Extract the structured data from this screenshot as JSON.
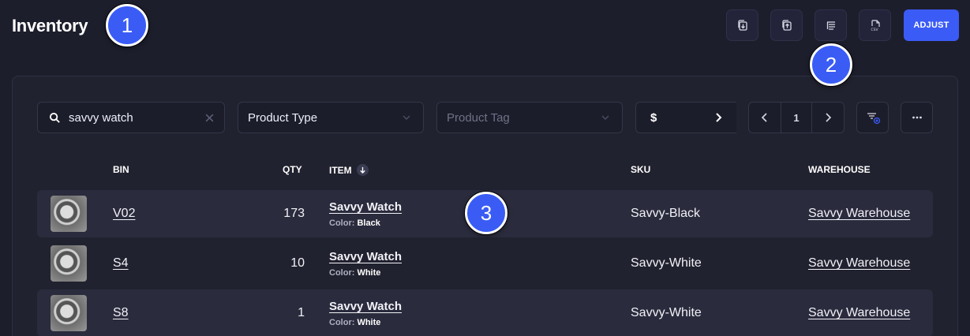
{
  "page": {
    "title": "Inventory"
  },
  "callouts": [
    "1",
    "2",
    "3"
  ],
  "toolbar": {
    "buttons": [
      "import-icon",
      "export-icon",
      "list-settings-icon",
      "csv-icon"
    ],
    "adjust_label": "ADJUST"
  },
  "filters": {
    "search_value": "savvy watch",
    "product_type": "Product Type",
    "product_tag": "Product Tag",
    "currency": "$",
    "page_number": "1"
  },
  "table": {
    "headers": {
      "bin": "BIN",
      "qty": "QTY",
      "item": "ITEM",
      "sku": "SKU",
      "warehouse": "WAREHOUSE"
    },
    "rows": [
      {
        "bin": "V02",
        "qty": "173",
        "item": "Savvy Watch",
        "attr_label": "Color:",
        "attr_value": "Black",
        "sku": "Savvy-Black",
        "warehouse": "Savvy Warehouse"
      },
      {
        "bin": "S4",
        "qty": "10",
        "item": "Savvy Watch",
        "attr_label": "Color:",
        "attr_value": "White",
        "sku": "Savvy-White",
        "warehouse": "Savvy Warehouse"
      },
      {
        "bin": "S8",
        "qty": "1",
        "item": "Savvy Watch",
        "attr_label": "Color:",
        "attr_value": "White",
        "sku": "Savvy-White",
        "warehouse": "Savvy Warehouse"
      }
    ]
  },
  "colors": {
    "accent": "#3b5bf6",
    "background": "#1d1e2c",
    "panel": "#21222f"
  }
}
